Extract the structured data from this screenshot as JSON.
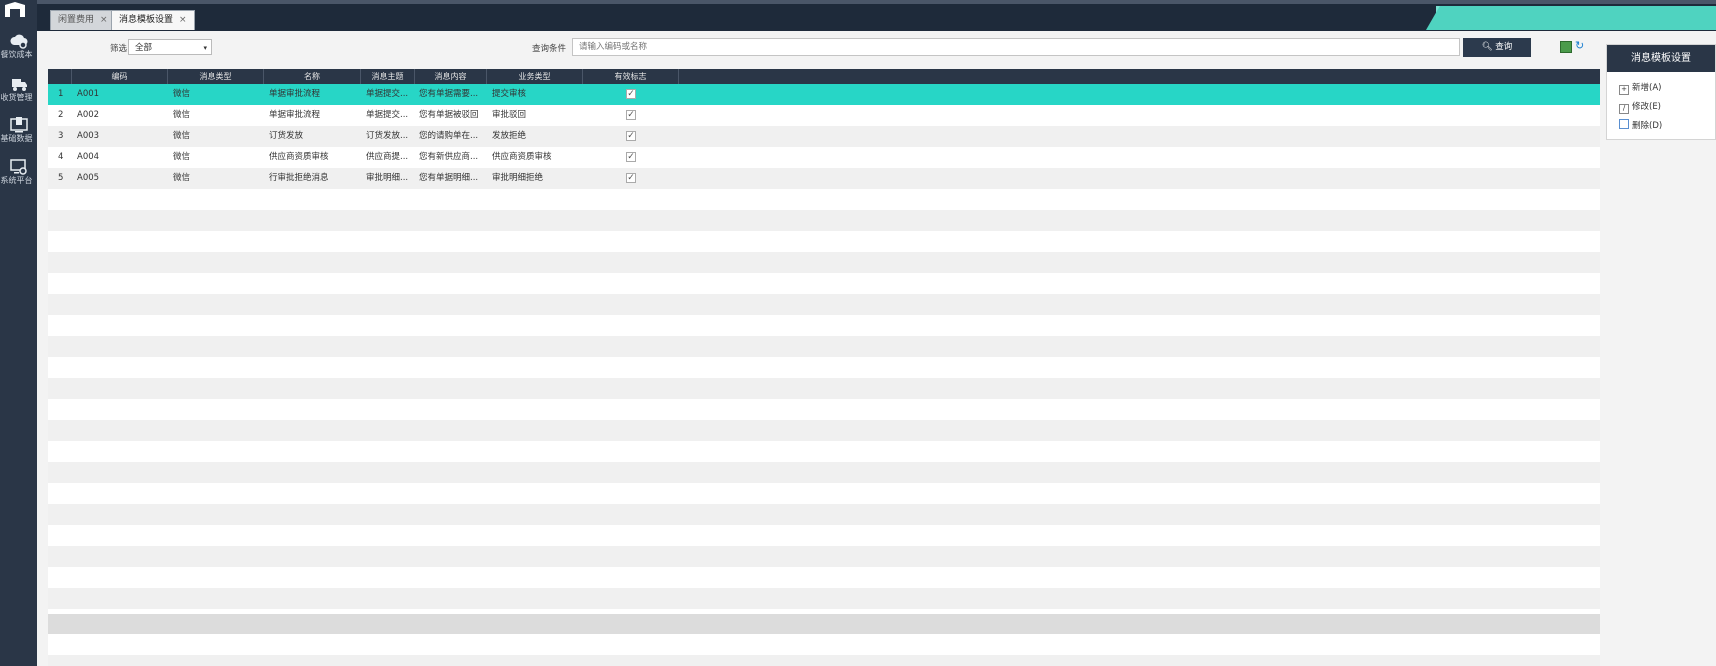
{
  "sidebar": {
    "items": [
      {
        "label": "餐饮成本",
        "icon": "cloud-settings-icon"
      },
      {
        "label": "收货管理",
        "icon": "truck-icon"
      },
      {
        "label": "基础数据",
        "icon": "monitor-data-icon"
      },
      {
        "label": "系统平台",
        "icon": "platform-settings-icon"
      }
    ]
  },
  "tabs": [
    {
      "label": "闲置费用",
      "close": "×"
    },
    {
      "label": "消息模板设置",
      "close": "×"
    }
  ],
  "filter": {
    "label": "筛选",
    "value": "全部",
    "arrow": "▾"
  },
  "search": {
    "label": "查询条件",
    "placeholder": "请输入编码或名称",
    "button": "查询"
  },
  "table": {
    "columns": [
      "编码",
      "消息类型",
      "名称",
      "消息主题",
      "消息内容",
      "业务类型",
      "有效标志"
    ],
    "rows": [
      {
        "idx": "1",
        "code": "A001",
        "type": "微信",
        "name": "单据审批流程",
        "subject": "单据提交...",
        "content": "您有单据需要...",
        "biz": "提交审核",
        "valid": "✓"
      },
      {
        "idx": "2",
        "code": "A002",
        "type": "微信",
        "name": "单据审批流程",
        "subject": "单据提交...",
        "content": "您有单据被驳回",
        "biz": "审批驳回",
        "valid": "✓"
      },
      {
        "idx": "3",
        "code": "A003",
        "type": "微信",
        "name": "订货发放",
        "subject": "订货发放...",
        "content": "您的请购单在...",
        "biz": "发放拒绝",
        "valid": "✓"
      },
      {
        "idx": "4",
        "code": "A004",
        "type": "微信",
        "name": "供应商资质审核",
        "subject": "供应商提...",
        "content": "您有新供应商...",
        "biz": "供应商资质审核",
        "valid": "✓"
      },
      {
        "idx": "5",
        "code": "A005",
        "type": "微信",
        "name": "行审批拒绝消息",
        "subject": "审批明细...",
        "content": "您有单据明细...",
        "biz": "审批明细拒绝",
        "valid": "✓"
      }
    ]
  },
  "right_panel": {
    "title": "消息模板设置",
    "actions": [
      {
        "label": "新增(A)",
        "icon": "plus-icon"
      },
      {
        "label": "修改(E)",
        "icon": "edit-icon"
      },
      {
        "label": "删除(D)",
        "icon": "trash-icon"
      }
    ]
  }
}
